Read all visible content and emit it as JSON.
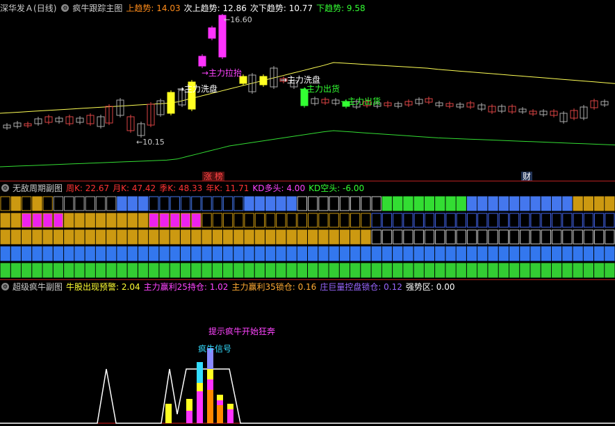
{
  "main_header": {
    "stock": "深华发Ａ",
    "period": "(日线)",
    "indicator": "疯牛跟踪主图",
    "items": [
      {
        "label": "上趋势",
        "value": "14.03",
        "color": "#ff8c1a"
      },
      {
        "label": "次上趋势",
        "value": "12.86",
        "color": "#ffffff"
      },
      {
        "label": "次下趋势",
        "value": "10.77",
        "color": "#ffffff"
      },
      {
        "label": "下趋势",
        "value": "9.58",
        "color": "#33ff33"
      }
    ]
  },
  "price_chart": {
    "high_label": "16.60",
    "low_label": "10.15",
    "annotations": [
      {
        "text": "主力拉抬",
        "color": "#ff44ff"
      },
      {
        "text": "主力洗盘",
        "color": "#ffffff"
      },
      {
        "text": "主力洗盘",
        "color": "#ffffff"
      },
      {
        "text": "主力出货",
        "color": "#33ff33"
      },
      {
        "text": "主力出货",
        "color": "#33ff33"
      }
    ],
    "badges": [
      {
        "text": "涨",
        "color": "#ff4444"
      },
      {
        "text": "榜",
        "color": "#ff4444"
      },
      {
        "text": "财",
        "color": "#ffffff"
      }
    ]
  },
  "period_panel": {
    "indicator": "无敌周期副图",
    "items": [
      {
        "label": "周K",
        "value": "22.67",
        "color": "#ff3333"
      },
      {
        "label": "月K",
        "value": "47.42",
        "color": "#ff3333"
      },
      {
        "label": "季K",
        "value": "48.33",
        "color": "#ff3333"
      },
      {
        "label": "年K",
        "value": "11.71",
        "color": "#ff3333"
      },
      {
        "label": "KD多头",
        "value": "4.00",
        "color": "#ff44ff"
      },
      {
        "label": "KD空头",
        "value": "-6.00",
        "color": "#33ff33"
      }
    ]
  },
  "bull_panel": {
    "indicator": "超级疯牛副图",
    "items": [
      {
        "label": "牛股出现预警",
        "value": "2.04",
        "color": "#ffff33"
      },
      {
        "label": "主力赢利25持仓",
        "value": "1.02",
        "color": "#ff44ff"
      },
      {
        "label": "主力赢利35锁仓",
        "value": "0.16",
        "color": "#ffaa33"
      },
      {
        "label": "庄巨量控盘锁仓",
        "value": "0.12",
        "color": "#9966ff"
      },
      {
        "label": "强势区",
        "value": "0.00",
        "color": "#ffffff"
      }
    ],
    "signal_top": "提示疯牛开始狂奔",
    "signal_bull": "疯牛信号"
  }
}
